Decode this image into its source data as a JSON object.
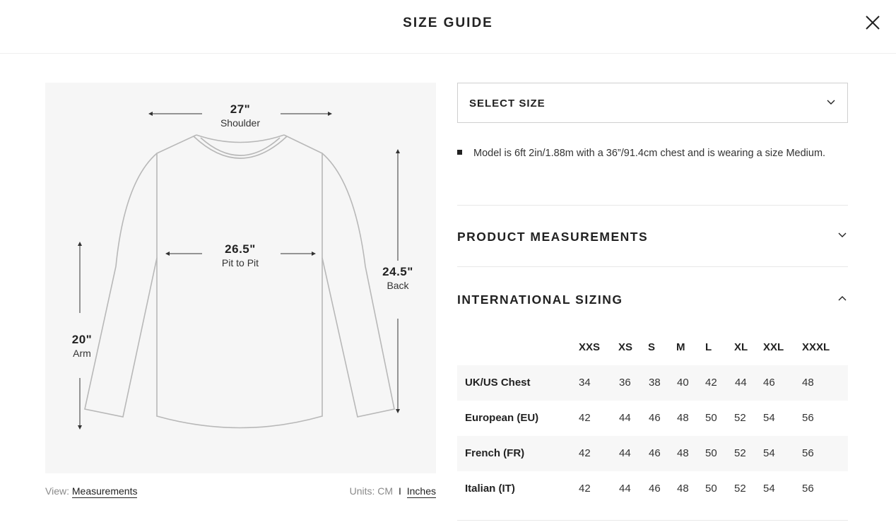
{
  "header": {
    "title": "SIZE GUIDE",
    "close_icon": "close-icon"
  },
  "diagram": {
    "shoulder": {
      "value": "27\"",
      "name": "Shoulder"
    },
    "pit": {
      "value": "26.5\"",
      "name": "Pit to Pit"
    },
    "back": {
      "value": "24.5\"",
      "name": "Back"
    },
    "arm": {
      "value": "20\"",
      "name": "Arm"
    }
  },
  "footer": {
    "view_label": "View:",
    "view_value": "Measurements",
    "units_label": "Units:",
    "unit_cm": "CM",
    "unit_sep": "I",
    "unit_inches": "Inches"
  },
  "select": {
    "label": "SELECT SIZE",
    "icon": "chevron-down-icon"
  },
  "note": "Model is 6ft 2in/1.88m with a 36”/91.4cm chest and is wearing a size Medium.",
  "sections": {
    "product_measurements": "PRODUCT MEASUREMENTS",
    "international_sizing": "INTERNATIONAL SIZING"
  },
  "table": {
    "sizes": [
      "XXS",
      "XS",
      "S",
      "M",
      "L",
      "XL",
      "XXL",
      "XXXL"
    ],
    "rows": [
      {
        "label": "UK/US Chest",
        "values": [
          "34",
          "36",
          "38",
          "40",
          "42",
          "44",
          "46",
          "48"
        ]
      },
      {
        "label": "European (EU)",
        "values": [
          "42",
          "44",
          "46",
          "48",
          "50",
          "52",
          "54",
          "56"
        ]
      },
      {
        "label": "French (FR)",
        "values": [
          "42",
          "44",
          "46",
          "48",
          "50",
          "52",
          "54",
          "56"
        ]
      },
      {
        "label": "Italian (IT)",
        "values": [
          "42",
          "44",
          "46",
          "48",
          "50",
          "52",
          "54",
          "56"
        ]
      }
    ]
  },
  "colors": {
    "text": "#222222",
    "diagram_bg": "#f6f6f6",
    "row_shade": "#f7f7f7",
    "outline": "#b8b8b8"
  }
}
